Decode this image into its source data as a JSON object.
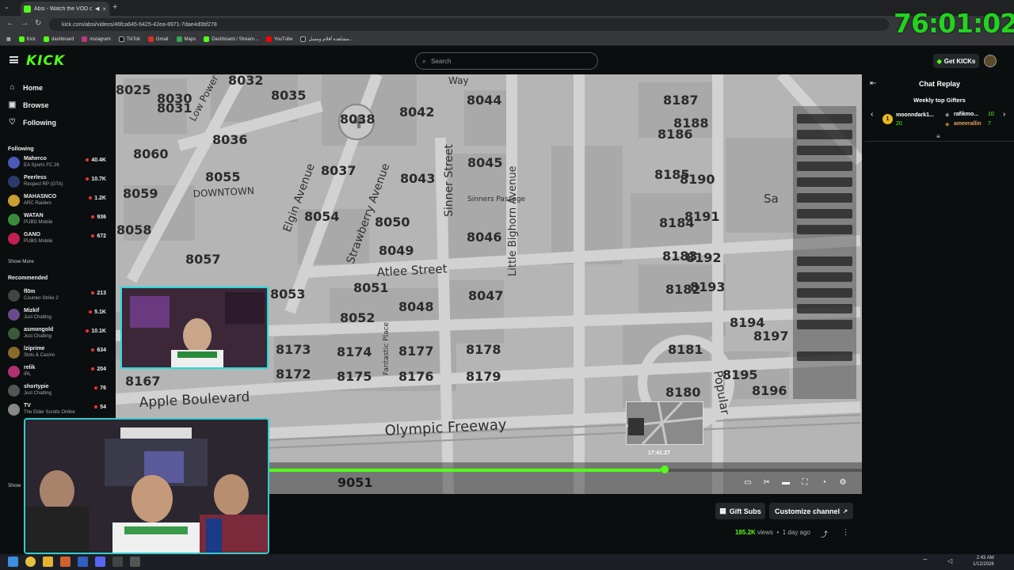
{
  "browser": {
    "tab_title": "Absi - Watch the VOD on K",
    "url": "kick.com/absi/videos/46fca645-6425-42ea-8971-7dae4d0bf278",
    "bookmarks": [
      "Kick",
      "dashboard",
      "instagram",
      "TikTok",
      "Gmail",
      "Maps",
      "Dashboard / Stream...",
      "YouTube",
      "مشاهدة أفلام ومسل..."
    ]
  },
  "overlay_timer": "76:01:02",
  "topnav": {
    "logo": "KICK",
    "search_placeholder": "Search",
    "get_kicks": "Get KICKs"
  },
  "sidebar": {
    "nav": [
      "Home",
      "Browse",
      "Following"
    ],
    "following_header": "Following",
    "following": [
      {
        "name": "Maherco",
        "game": "EA Sports FC 26",
        "viewers": "40.4K",
        "color": "#4a5ab8"
      },
      {
        "name": "Peerless",
        "game": "Respect RP (GTA)",
        "viewers": "10.7K",
        "color": "#2a3a6a"
      },
      {
        "name": "MAHASNCO",
        "game": "ARC Raiders",
        "viewers": "1.2K",
        "color": "#c9a030"
      },
      {
        "name": "WATAN",
        "game": "PUBG Mobile",
        "viewers": "936",
        "color": "#3a8a3a"
      },
      {
        "name": "GANO",
        "game": "PUBG Mobile",
        "viewers": "672",
        "color": "#c02050"
      }
    ],
    "show_more_1": "Show More",
    "recommended_header": "Recommended",
    "recommended": [
      {
        "name": "fl0m",
        "game": "Counter-Strike 2",
        "viewers": "213",
        "color": "#444"
      },
      {
        "name": "Mizkif",
        "game": "Just Chatting",
        "viewers": "5.1K",
        "color": "#6a4a8a"
      },
      {
        "name": "asmongold",
        "game": "Just Chatting",
        "viewers": "10.1K",
        "color": "#3a5a3a"
      },
      {
        "name": "lziprime",
        "game": "Slots & Casino",
        "viewers": "634",
        "color": "#8a6a2a"
      },
      {
        "name": "relik",
        "game": "IRL",
        "viewers": "204",
        "color": "#b03070"
      },
      {
        "name": "shortypie",
        "game": "Just Chatting",
        "viewers": "76",
        "color": "#555"
      },
      {
        "name": "TV",
        "game": "The Elder Scrolls Online",
        "viewers": "54",
        "color": "#888"
      }
    ],
    "show_more_2": "Show"
  },
  "map": {
    "blocks": [
      "8025",
      "8030",
      "8032",
      "8035",
      "8038",
      "8042",
      "8044",
      "8187",
      "8031",
      "8036",
      "8060",
      "8037",
      "8045",
      "8186",
      "8188",
      "8043",
      "8055",
      "8185",
      "8190",
      "8059",
      "8054",
      "8050",
      "8058",
      "8046",
      "8184",
      "8191",
      "8049",
      "8057",
      "8183",
      "8192",
      "8051",
      "8047",
      "8182",
      "8193",
      "8053",
      "8048",
      "8052",
      "8194",
      "8197",
      "8173",
      "8174",
      "8177",
      "8178",
      "8181",
      "8172",
      "8175",
      "8176",
      "8179",
      "8195",
      "8180",
      "8196",
      "8167",
      "9051"
    ],
    "streets": [
      "Way",
      "Low Power",
      "Elgin Avenue",
      "Strawberry Avenue",
      "Sinner Street",
      "Little Bighorn Avenue",
      "Atlee Street",
      "Apple Boulevard",
      "Olympic Freeway",
      "Popular",
      "Fantastic Place",
      "Sinners Passage",
      "DOWNTOWN",
      "Sa"
    ]
  },
  "player": {
    "preview_time": "17:41:27",
    "progress": 0.66
  },
  "chat": {
    "title": "Chat Replay",
    "gifters_title": "Weekly top Gifters",
    "gifters": [
      {
        "rank": "1",
        "name": "moonndark1...",
        "count": "20"
      },
      {
        "name": "rafikmo...",
        "count": "10"
      },
      {
        "name": "ameerallin",
        "count": "7"
      }
    ]
  },
  "actions": {
    "gift_subs": "Gift Subs",
    "customize": "Customize channel",
    "views": "185.2K",
    "views_label": "views",
    "age": "1 day ago"
  },
  "taskbar": {
    "time": "2:43 AM",
    "date": "1/12/2026"
  }
}
